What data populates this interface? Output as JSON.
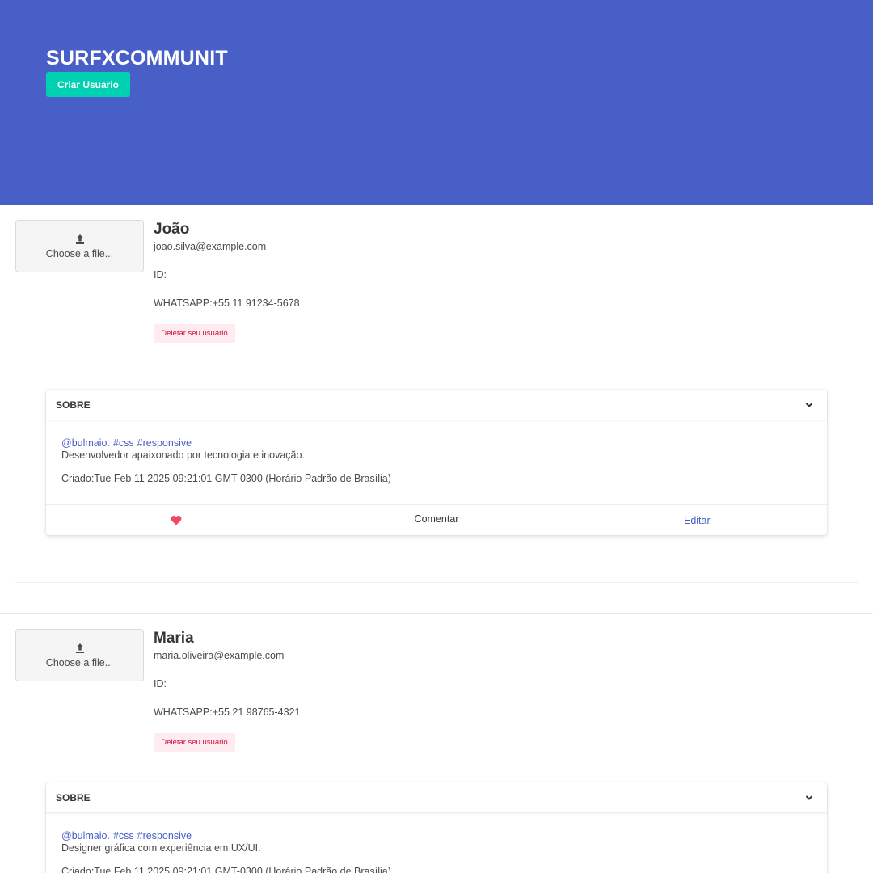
{
  "header": {
    "title": "SURFXCOMMUNIT",
    "create_button": "Criar Usuario"
  },
  "users": [
    {
      "upload_label": "Choose a file...",
      "name": "João",
      "email": "joao.silva@example.com",
      "id_label": "ID:",
      "whatsapp": "WHATSAPP:+55 11 91234-5678",
      "delete_label": "Deletar seu usuario",
      "card": {
        "title": "SOBRE",
        "tags": [
          "@bulmaio.",
          "#css",
          "#responsive"
        ],
        "bio": "Desenvolvedor apaixonado por tecnologia e inovação.",
        "created": "Criado:Tue Feb 11 2025 09:21:01 GMT-0300 (Horário Padrão de Brasília)",
        "comment_label": "Comentar",
        "edit_label": "Editar"
      }
    },
    {
      "upload_label": "Choose a file...",
      "name": "Maria",
      "email": "maria.oliveira@example.com",
      "id_label": "ID:",
      "whatsapp": "WHATSAPP:+55 21 98765-4321",
      "delete_label": "Deletar seu usuario",
      "card": {
        "title": "SOBRE",
        "tags": [
          "@bulmaio.",
          "#css",
          "#responsive"
        ],
        "bio": "Designer gráfica com experiência em UX/UI.",
        "created": "Criado:Tue Feb 11 2025 09:21:01 GMT-0300 (Horário Padrão de Brasília)"
      }
    }
  ],
  "colors": {
    "primary": "#485fc7",
    "accent": "#00d1b2",
    "danger_light": "#feecf0",
    "danger_text": "#cc0f35",
    "heart": "#f14668"
  },
  "icons": [
    "upload-icon",
    "chevron-down-icon",
    "heart-icon"
  ]
}
